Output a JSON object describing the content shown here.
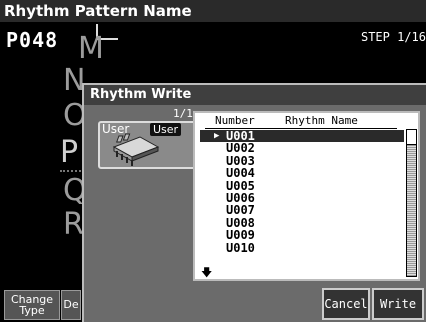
{
  "header": {
    "title": "Rhythm Pattern Name",
    "pattern_number": "P048",
    "step": "STEP 1/16"
  },
  "background_letters": [
    "M",
    "N",
    "O",
    "P",
    "Q",
    "R"
  ],
  "bottom_buttons": {
    "change_type": "Change Type",
    "partial": "De"
  },
  "dialog": {
    "title": "Rhythm Write",
    "page_indicator": "1/1",
    "destination_label": "User",
    "destination_badge": "User",
    "list": {
      "columns": [
        "Number",
        "Rhythm Name"
      ],
      "selected_index": 0,
      "rows": [
        {
          "number": "U001",
          "name": ""
        },
        {
          "number": "U002",
          "name": ""
        },
        {
          "number": "U003",
          "name": ""
        },
        {
          "number": "U004",
          "name": ""
        },
        {
          "number": "U005",
          "name": ""
        },
        {
          "number": "U006",
          "name": ""
        },
        {
          "number": "U007",
          "name": ""
        },
        {
          "number": "U008",
          "name": ""
        },
        {
          "number": "U009",
          "name": ""
        },
        {
          "number": "U010",
          "name": ""
        }
      ]
    },
    "buttons": {
      "cancel": "Cancel",
      "write": "Write"
    }
  },
  "icons": {
    "selection": "triangle-right-icon",
    "more_below": "arrow-down-icon",
    "memory": "memory-chip-icon"
  }
}
